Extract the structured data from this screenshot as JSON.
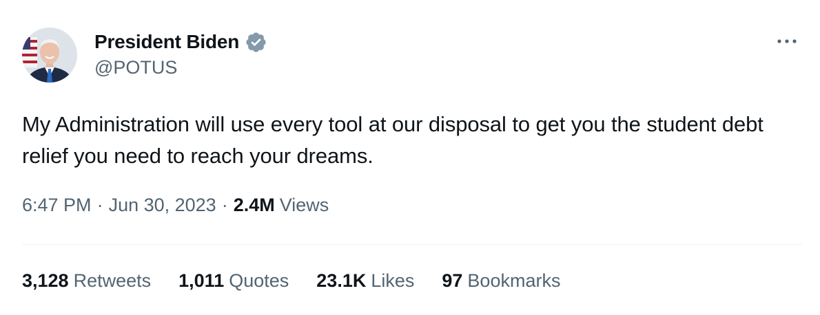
{
  "author": {
    "display_name": "President Biden",
    "handle": "@POTUS",
    "verified_badge_icon": "verified-badge-icon",
    "badge_color": "#829aab"
  },
  "avatar": {
    "icon": "profile-photo"
  },
  "more_menu": {
    "icon": "more-horizontal-icon"
  },
  "tweet": {
    "text": "My Administration will use every tool at our disposal to get you the student debt relief you need to reach your dreams."
  },
  "meta": {
    "time": "6:47 PM",
    "separator": "·",
    "date": "Jun 30, 2023",
    "views_count": "2.4M",
    "views_label": "Views"
  },
  "stats": [
    {
      "count": "3,128",
      "label": "Retweets"
    },
    {
      "count": "1,011",
      "label": "Quotes"
    },
    {
      "count": "23.1K",
      "label": "Likes"
    },
    {
      "count": "97",
      "label": "Bookmarks"
    }
  ],
  "colors": {
    "primary_text": "#0f1419",
    "secondary_text": "#536471",
    "divider": "#eff3f4"
  }
}
